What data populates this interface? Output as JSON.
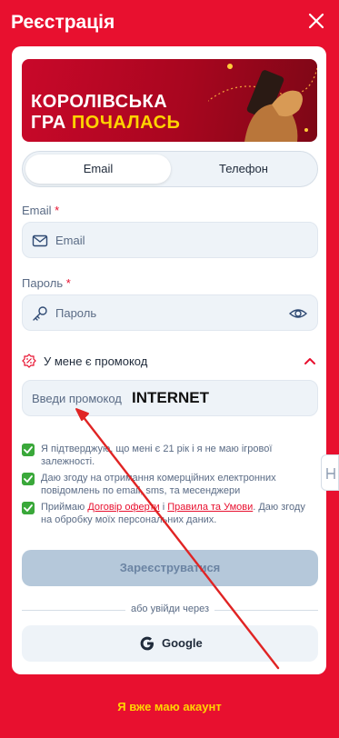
{
  "header": {
    "title": "Реєстрація",
    "close_icon": "close-icon"
  },
  "banner": {
    "line1": "КОРОЛІВСЬКА",
    "line2_white": "ГРА ",
    "line2_yellow": "ПОЧАЛАСЬ"
  },
  "tabs": [
    {
      "label": "Email",
      "active": true
    },
    {
      "label": "Телефон",
      "active": false
    }
  ],
  "email": {
    "label": "Email",
    "required_mark": "*",
    "placeholder": "Email",
    "icon": "mail-icon"
  },
  "password": {
    "label": "Пароль",
    "required_mark": "*",
    "placeholder": "Пароль",
    "icon": "key-icon",
    "toggle_icon": "eye-icon"
  },
  "promo": {
    "toggle_label": "У мене є промокод",
    "icon": "promo-badge-icon",
    "chevron_icon": "chevron-up-icon",
    "placeholder": "Введи промокод",
    "overlay_text": "INTERNET"
  },
  "consents": [
    {
      "text": "Я підтверджую, що мені є 21 рік і я не маю ігрової залежності.",
      "checked": true
    },
    {
      "text": "Даю згоду на отримання комерційних електронних повідомлень по email, sms, та месенджери",
      "checked": true
    },
    {
      "text_before": "Приймаю ",
      "link1": "Договір оферти",
      "text_mid": " і ",
      "link2": "Правила та Умови",
      "text_after": ". Даю згоду на обробку моїх персональних даних.",
      "checked": true
    }
  ],
  "register_button": "Зареєструватися",
  "divider_text": "або увійди через",
  "google_button": {
    "label": "Google",
    "icon": "google-icon"
  },
  "footer_link": "Я вже маю акаунт",
  "colors": {
    "brand": "#e8102f",
    "accent_yellow": "#ffd400",
    "check_green": "#3aa83a",
    "button_disabled": "#b5c8da"
  }
}
